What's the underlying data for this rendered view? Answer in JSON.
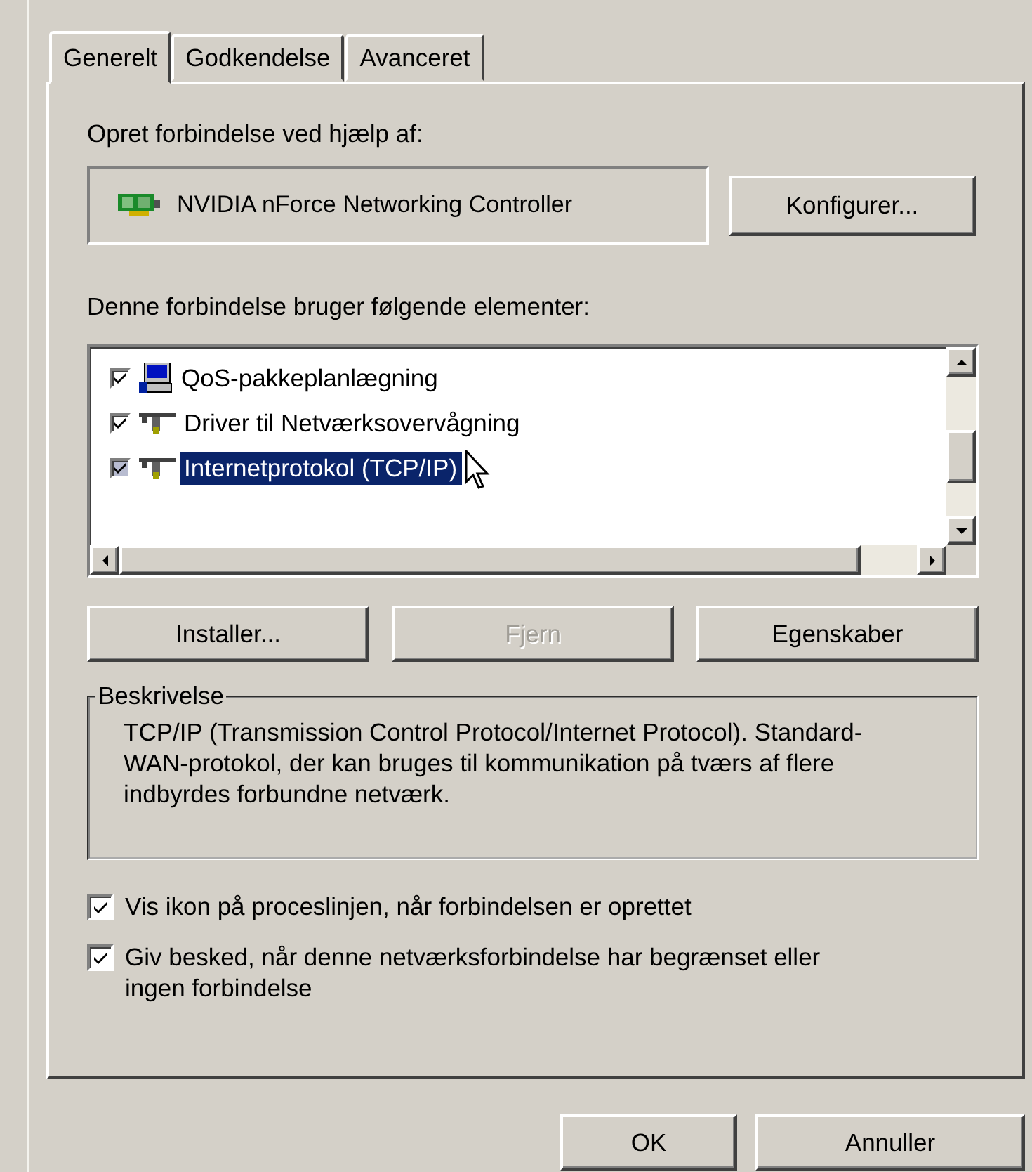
{
  "tabs": [
    {
      "label": "Generelt",
      "selected": true
    },
    {
      "label": "Godkendelse",
      "selected": false
    },
    {
      "label": "Avanceret",
      "selected": false
    }
  ],
  "connect_label": "Opret forbindelse ved hjælp af:",
  "adapter": {
    "name": "NVIDIA nForce Networking Controller"
  },
  "configure_button": "Konfigurer...",
  "components_label": "Denne forbindelse bruger følgende elementer:",
  "components": [
    {
      "label": "QoS-pakkeplanlægning",
      "checked": true,
      "selected": false,
      "kind": "scheduler"
    },
    {
      "label": "Driver til Netværksovervågning",
      "checked": true,
      "selected": false,
      "kind": "protocol"
    },
    {
      "label": "Internetprotokol (TCP/IP)",
      "checked": true,
      "selected": true,
      "kind": "protocol"
    }
  ],
  "component_buttons": [
    {
      "label": "Installer...",
      "disabled": false
    },
    {
      "label": "Fjern",
      "disabled": true
    },
    {
      "label": "Egenskaber",
      "disabled": false
    }
  ],
  "description": {
    "title": "Beskrivelse",
    "text": "TCP/IP (Transmission Control Protocol/Internet Protocol). Standard-WAN-protokol, der kan bruges til kommunikation på tværs af flere indbyrdes forbundne netværk."
  },
  "options": [
    {
      "label": "Vis ikon på proceslinjen, når forbindelsen er oprettet",
      "checked": true
    },
    {
      "label": "Giv besked, når denne netværksforbindelse har begrænset eller ingen forbindelse",
      "checked": true
    }
  ],
  "dialog_buttons": [
    "OK",
    "Annuller"
  ]
}
